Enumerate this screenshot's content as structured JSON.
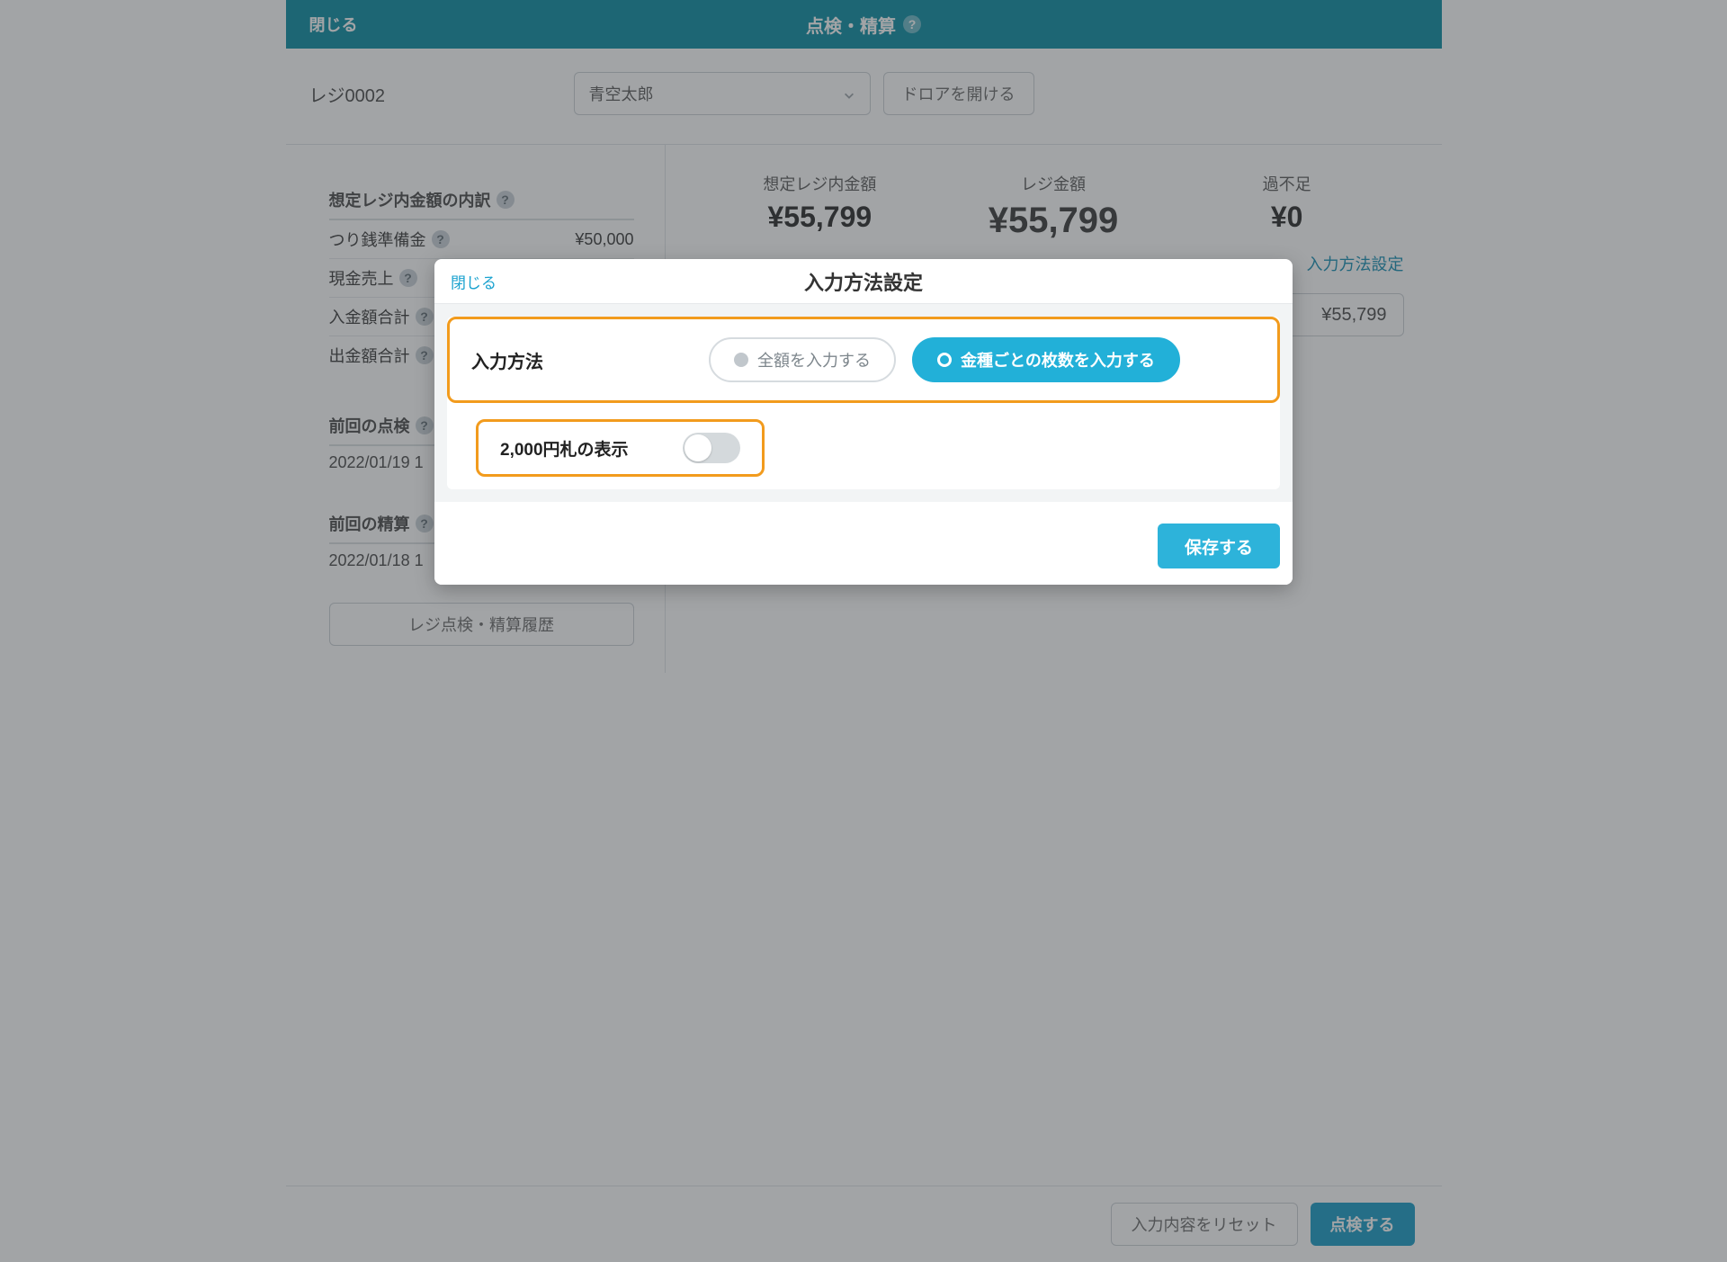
{
  "topbar": {
    "close": "閉じる",
    "title": "点検・精算"
  },
  "register": {
    "label": "レジ0002",
    "staff": "青空太郎",
    "open_drawer": "ドロアを開ける"
  },
  "breakdown": {
    "heading": "想定レジ内金額の内訳",
    "rows": [
      {
        "k": "つり銭準備金",
        "v": "¥50,000"
      },
      {
        "k": "現金売上",
        "v": ""
      },
      {
        "k": "入金額合計",
        "v": ""
      },
      {
        "k": "出金額合計",
        "v": ""
      }
    ],
    "last_check_head": "前回の点検",
    "last_check_date": "2022/01/19 1",
    "last_settle_head": "前回の精算",
    "last_settle_date": "2022/01/18 1",
    "history_btn": "レジ点検・精算履歴"
  },
  "amounts": {
    "expected_cap": "想定レジ内金額",
    "expected": "¥55,799",
    "register_cap": "レジ金額",
    "register": "¥55,799",
    "diff_cap": "過不足",
    "diff": "¥0"
  },
  "input_method_link": "入力方法設定",
  "total_field": "¥55,799",
  "footer": {
    "reset": "入力内容をリセット",
    "action": "点検する"
  },
  "modal": {
    "close": "閉じる",
    "title": "入力方法設定",
    "method_label": "入力方法",
    "opt_total": "全額を入力する",
    "opt_denom": "金種ごとの枚数を入力する",
    "bill2000_label": "2,000円札の表示",
    "save": "保存する"
  }
}
